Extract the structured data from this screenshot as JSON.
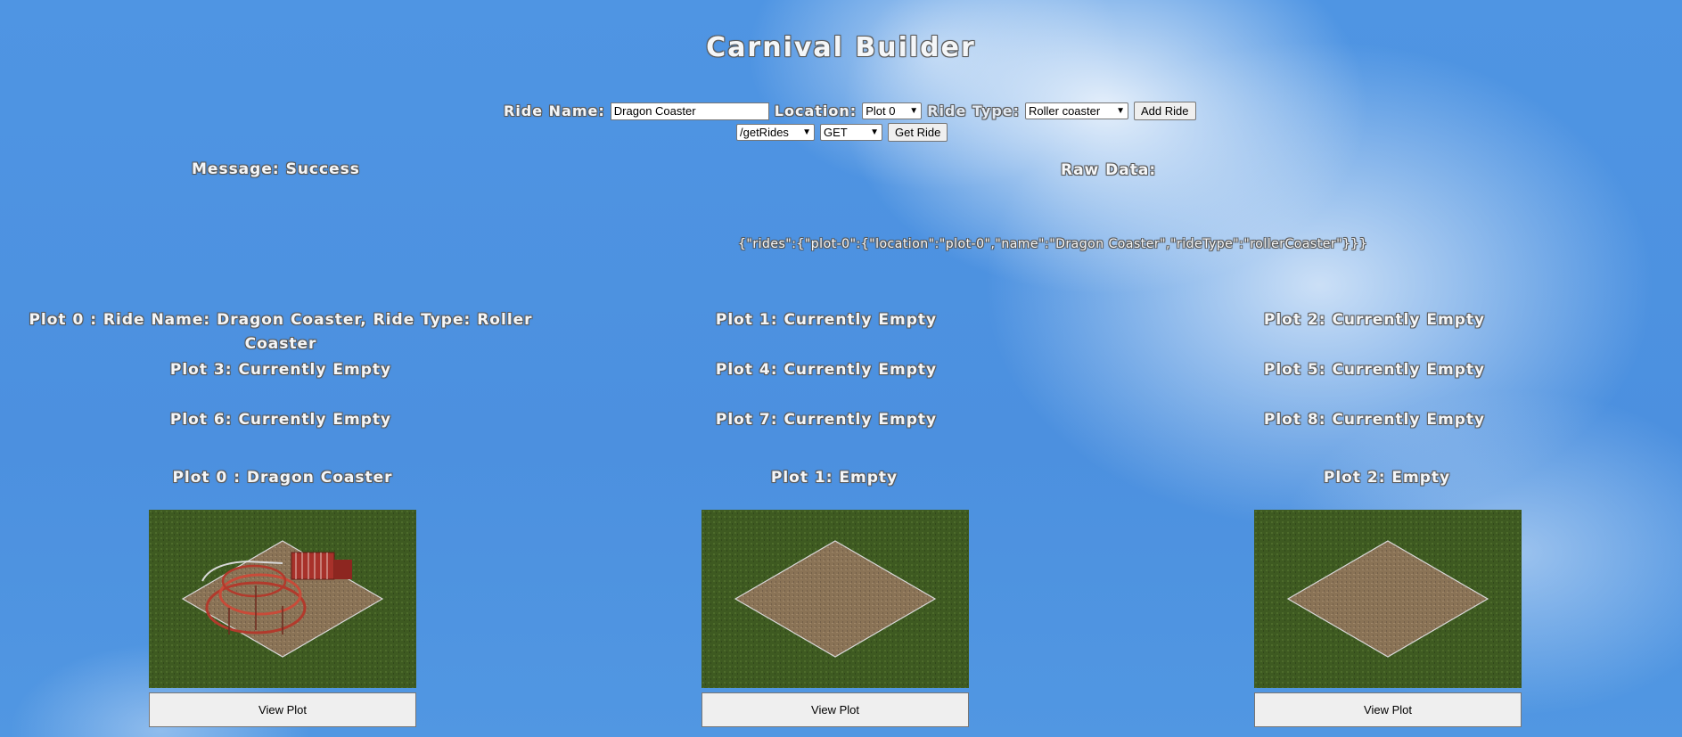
{
  "header": {
    "title": "Carnival Builder"
  },
  "form": {
    "ride_name_label": "Ride Name:",
    "ride_name_value": "Dragon Coaster",
    "location_label": "Location:",
    "location_value": "Plot 0",
    "ride_type_label": "Ride Type:",
    "ride_type_value": "Roller coaster",
    "add_button": "Add Ride",
    "endpoint_value": "/getRides",
    "method_value": "GET",
    "get_button": "Get Ride"
  },
  "status": {
    "message": "Message: Success",
    "raw_label": "Raw Data:",
    "raw_data": "{\"rides\":{\"plot-0\":{\"location\":\"plot-0\",\"name\":\"Dragon Coaster\",\"rideType\":\"rollerCoaster\"}}}"
  },
  "plots": [
    {
      "text": "Plot 0 : Ride Name: Dragon Coaster, Ride Type: Roller Coaster"
    },
    {
      "text": "Plot 1: Currently Empty"
    },
    {
      "text": "Plot 2: Currently Empty"
    },
    {
      "text": "Plot 3: Currently Empty"
    },
    {
      "text": "Plot 4: Currently Empty"
    },
    {
      "text": "Plot 5: Currently Empty"
    },
    {
      "text": "Plot 6: Currently Empty"
    },
    {
      "text": "Plot 7: Currently Empty"
    },
    {
      "text": "Plot 8: Currently Empty"
    }
  ],
  "cards": [
    {
      "title": "Plot 0 : Dragon Coaster",
      "button": "View Plot",
      "image": "roller-coaster"
    },
    {
      "title": "Plot 1: Empty",
      "button": "View Plot",
      "image": "empty-plot"
    },
    {
      "title": "Plot 2: Empty",
      "button": "View Plot",
      "image": "empty-plot"
    }
  ],
  "colors": {
    "grass": "#3f5a22",
    "dirt": "#8a7356",
    "track": "#b23a2c"
  }
}
